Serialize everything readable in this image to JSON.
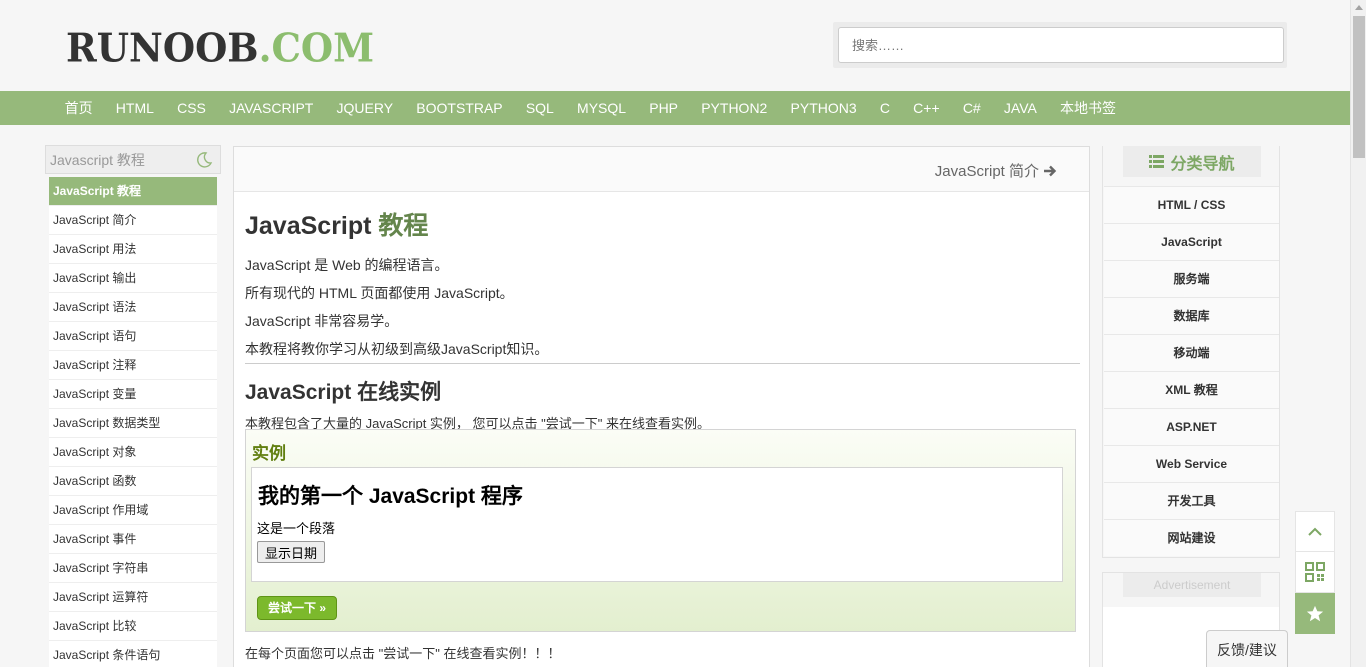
{
  "header": {
    "logo_main": "RUNOOB",
    "logo_com": ".COM",
    "search_placeholder": "搜索……"
  },
  "nav": {
    "items": [
      "首页",
      "HTML",
      "CSS",
      "JAVASCRIPT",
      "JQUERY",
      "BOOTSTRAP",
      "SQL",
      "MYSQL",
      "PHP",
      "PYTHON2",
      "PYTHON3",
      "C",
      "C++",
      "C#",
      "JAVA",
      "本地书签"
    ]
  },
  "left_sidebar": {
    "title": "Javascript 教程",
    "items": [
      {
        "label": "JavaScript 教程",
        "active": true
      },
      {
        "label": "JavaScript 简介"
      },
      {
        "label": "JavaScript 用法"
      },
      {
        "label": "JavaScript 输出"
      },
      {
        "label": "JavaScript 语法"
      },
      {
        "label": "JavaScript 语句"
      },
      {
        "label": "JavaScript 注释"
      },
      {
        "label": "JavaScript 变量"
      },
      {
        "label": "JavaScript 数据类型"
      },
      {
        "label": "JavaScript 对象"
      },
      {
        "label": "JavaScript 函数"
      },
      {
        "label": "JavaScript 作用域"
      },
      {
        "label": "JavaScript 事件"
      },
      {
        "label": "JavaScript 字符串"
      },
      {
        "label": "JavaScript 运算符"
      },
      {
        "label": "JavaScript 比较"
      },
      {
        "label": "JavaScript 条件语句"
      }
    ]
  },
  "main": {
    "next_link": "JavaScript 简介",
    "title_plain": "JavaScript",
    "title_highlight": "教程",
    "paragraphs": [
      "JavaScript 是 Web 的编程语言。",
      "所有现代的 HTML 页面都使用 JavaScript。",
      "JavaScript 非常容易学。",
      "本教程将教你学习从初级到高级JavaScript知识。"
    ],
    "subtitle": "JavaScript 在线实例",
    "intro": "本教程包含了大量的 JavaScript 实例， 您可以点击 \"尝试一下\" 来在线查看实例。",
    "example": {
      "label": "实例",
      "heading": "我的第一个 JavaScript 程序",
      "paragraph": "这是一个段落",
      "button": "显示日期",
      "try_button": "尝试一下 »"
    },
    "bottom_text": "在每个页面您可以点击 \"尝试一下\" 在线查看实例！！！"
  },
  "right_sidebar": {
    "title": "分类导航",
    "items": [
      "HTML / CSS",
      "JavaScript",
      "服务端",
      "数据库",
      "移动端",
      "XML 教程",
      "ASP.NET",
      "Web Service",
      "开发工具",
      "网站建设"
    ]
  },
  "ad": {
    "title": "Advertisement"
  },
  "feedback": "反馈/建议",
  "colors": {
    "accent": "#96b97b",
    "title_green": "#64854c",
    "try_green": "#7cb92c"
  }
}
